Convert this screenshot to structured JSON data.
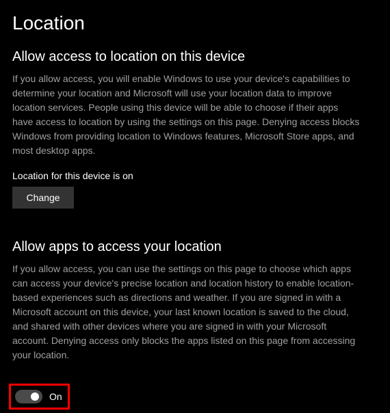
{
  "page": {
    "title": "Location"
  },
  "sections": {
    "device_access": {
      "heading": "Allow access to location on this device",
      "description": "If you allow access, you will enable Windows to use your device's capabilities to determine your location and Microsoft will use your location data to improve location services. People using this device will be able to choose if their apps have access to location by using the settings on this page. Denying access blocks Windows from providing location to Windows features, Microsoft Store apps, and most desktop apps.",
      "status": "Location for this device is on",
      "change_button_label": "Change"
    },
    "app_access": {
      "heading": "Allow apps to access your location",
      "description": "If you allow access, you can use the settings on this page to choose which apps can access your device's precise location and location history to enable location-based experiences such as directions and weather. If you are signed in with a Microsoft account on this device, your last known location is saved to the cloud, and shared with other devices where you are signed in with your Microsoft account. Denying access only blocks the apps listed on this page from accessing your location.",
      "toggle": {
        "state": "on",
        "label": "On"
      }
    }
  }
}
